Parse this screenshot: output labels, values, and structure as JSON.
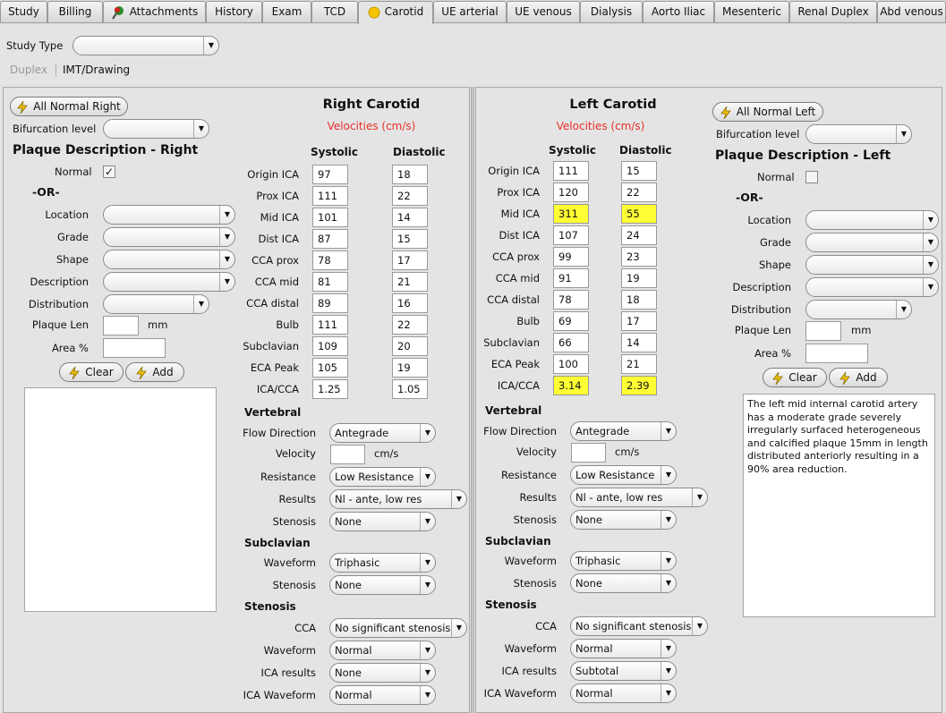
{
  "tabs": [
    {
      "label": "Study"
    },
    {
      "label": "Billing"
    },
    {
      "label": "Attachments"
    },
    {
      "label": "History"
    },
    {
      "label": "Exam"
    },
    {
      "label": "TCD"
    },
    {
      "label": "Carotid"
    },
    {
      "label": "UE arterial"
    },
    {
      "label": "UE venous"
    },
    {
      "label": "Dialysis"
    },
    {
      "label": "Aorto Iliac"
    },
    {
      "label": "Mesenteric"
    },
    {
      "label": "Renal Duplex"
    },
    {
      "label": "Abd venous"
    }
  ],
  "header": {
    "study_type_label": "Study Type",
    "subtabs": [
      {
        "label": "Duplex"
      },
      {
        "label": "IMT/Drawing"
      }
    ]
  },
  "right": {
    "all_normal": "All Normal Right",
    "bifurcation_label": "Bifurcation level",
    "plaque_title": "Plaque Description - Right",
    "normal_label": "Normal",
    "normal_checked": "✓",
    "or_label": "-OR-",
    "location_label": "Location",
    "grade_label": "Grade",
    "shape_label": "Shape",
    "description_label": "Description",
    "distribution_label": "Distribution",
    "plaque_len_label": "Plaque Len",
    "mm": "mm",
    "area_label": "Area %",
    "clear": "Clear",
    "add": "Add",
    "notes": "",
    "carotid_title": "Right Carotid",
    "velocities": "Velocities (cm/s)",
    "systolic": "Systolic",
    "diastolic": "Diastolic",
    "rows": [
      {
        "label": "Origin ICA",
        "sys": "97",
        "dia": "18"
      },
      {
        "label": "Prox ICA",
        "sys": "111",
        "dia": "22"
      },
      {
        "label": "Mid ICA",
        "sys": "101",
        "dia": "14"
      },
      {
        "label": "Dist ICA",
        "sys": "87",
        "dia": "15"
      },
      {
        "label": "CCA prox",
        "sys": "78",
        "dia": "17"
      },
      {
        "label": "CCA mid",
        "sys": "81",
        "dia": "21"
      },
      {
        "label": "CCA distal",
        "sys": "89",
        "dia": "16"
      },
      {
        "label": "Bulb",
        "sys": "111",
        "dia": "22"
      },
      {
        "label": "Subclavian",
        "sys": "109",
        "dia": "20"
      },
      {
        "label": "ECA Peak",
        "sys": "105",
        "dia": "19"
      },
      {
        "label": "ICA/CCA",
        "sys": "1.25",
        "dia": "1.05"
      }
    ],
    "vertebral_title": "Vertebral",
    "flow_direction_label": "Flow Direction",
    "flow_direction": "Antegrade",
    "velocity_label": "Velocity",
    "cms": "cm/s",
    "resistance_label": "Resistance",
    "resistance": "Low Resistance",
    "results_label": "Results",
    "results": "Nl - ante, low res",
    "stenosis_label": "Stenosis",
    "stenosis": "None",
    "subclavian_title": "Subclavian",
    "waveform_label": "Waveform",
    "sub_waveform": "Triphasic",
    "sub_stenosis": "None",
    "stenosis_title": "Stenosis",
    "cca_label": "CCA",
    "cca": "No significant stenosis",
    "st_waveform": "Normal",
    "ica_results_label": "ICA results",
    "ica_results": "None",
    "ica_waveform_label": "ICA Waveform",
    "ica_waveform": "Normal"
  },
  "left": {
    "all_normal": "All Normal Left",
    "bifurcation_label": "Bifurcation level",
    "plaque_title": "Plaque Description - Left",
    "normal_label": "Normal",
    "or_label": "-OR-",
    "location_label": "Location",
    "grade_label": "Grade",
    "shape_label": "Shape",
    "description_label": "Description",
    "distribution_label": "Distribution",
    "plaque_len_label": "Plaque Len",
    "mm": "mm",
    "area_label": "Area %",
    "clear": "Clear",
    "add": "Add",
    "notes": "The left mid internal carotid artery has a moderate grade severely irregularly surfaced heterogeneous and calcified plaque 15mm in length distributed anteriorly resulting in a 90% area reduction.",
    "carotid_title": "Left Carotid",
    "velocities": "Velocities (cm/s)",
    "systolic": "Systolic",
    "diastolic": "Diastolic",
    "rows": [
      {
        "label": "Origin ICA",
        "sys": "111",
        "dia": "15"
      },
      {
        "label": "Prox ICA",
        "sys": "120",
        "dia": "22"
      },
      {
        "label": "Mid ICA",
        "sys": "311",
        "dia": "55"
      },
      {
        "label": "Dist ICA",
        "sys": "107",
        "dia": "24"
      },
      {
        "label": "CCA prox",
        "sys": "99",
        "dia": "23"
      },
      {
        "label": "CCA mid",
        "sys": "91",
        "dia": "19"
      },
      {
        "label": "CCA distal",
        "sys": "78",
        "dia": "18"
      },
      {
        "label": "Bulb",
        "sys": "69",
        "dia": "17"
      },
      {
        "label": "Subclavian",
        "sys": "66",
        "dia": "14"
      },
      {
        "label": "ECA Peak",
        "sys": "100",
        "dia": "21"
      },
      {
        "label": "ICA/CCA",
        "sys": "3.14",
        "dia": "2.39"
      }
    ],
    "vertebral_title": "Vertebral",
    "flow_direction_label": "Flow Direction",
    "flow_direction": "Antegrade",
    "velocity_label": "Velocity",
    "cms": "cm/s",
    "resistance_label": "Resistance",
    "resistance": "Low Resistance",
    "results_label": "Results",
    "results": "Nl - ante, low res",
    "stenosis_label": "Stenosis",
    "stenosis": "None",
    "subclavian_title": "Subclavian",
    "waveform_label": "Waveform",
    "sub_waveform": "Triphasic",
    "sub_stenosis": "None",
    "stenosis_title": "Stenosis",
    "cca_label": "CCA",
    "cca": "No significant stenosis",
    "st_waveform": "Normal",
    "ica_results_label": "ICA results",
    "ica_results": "Subtotal",
    "ica_waveform_label": "ICA Waveform",
    "ica_waveform": "Normal"
  },
  "colors": {
    "highlight": "#ffff33",
    "accent_red": "#e8302a",
    "active_tab_icon": "#f5c400"
  }
}
